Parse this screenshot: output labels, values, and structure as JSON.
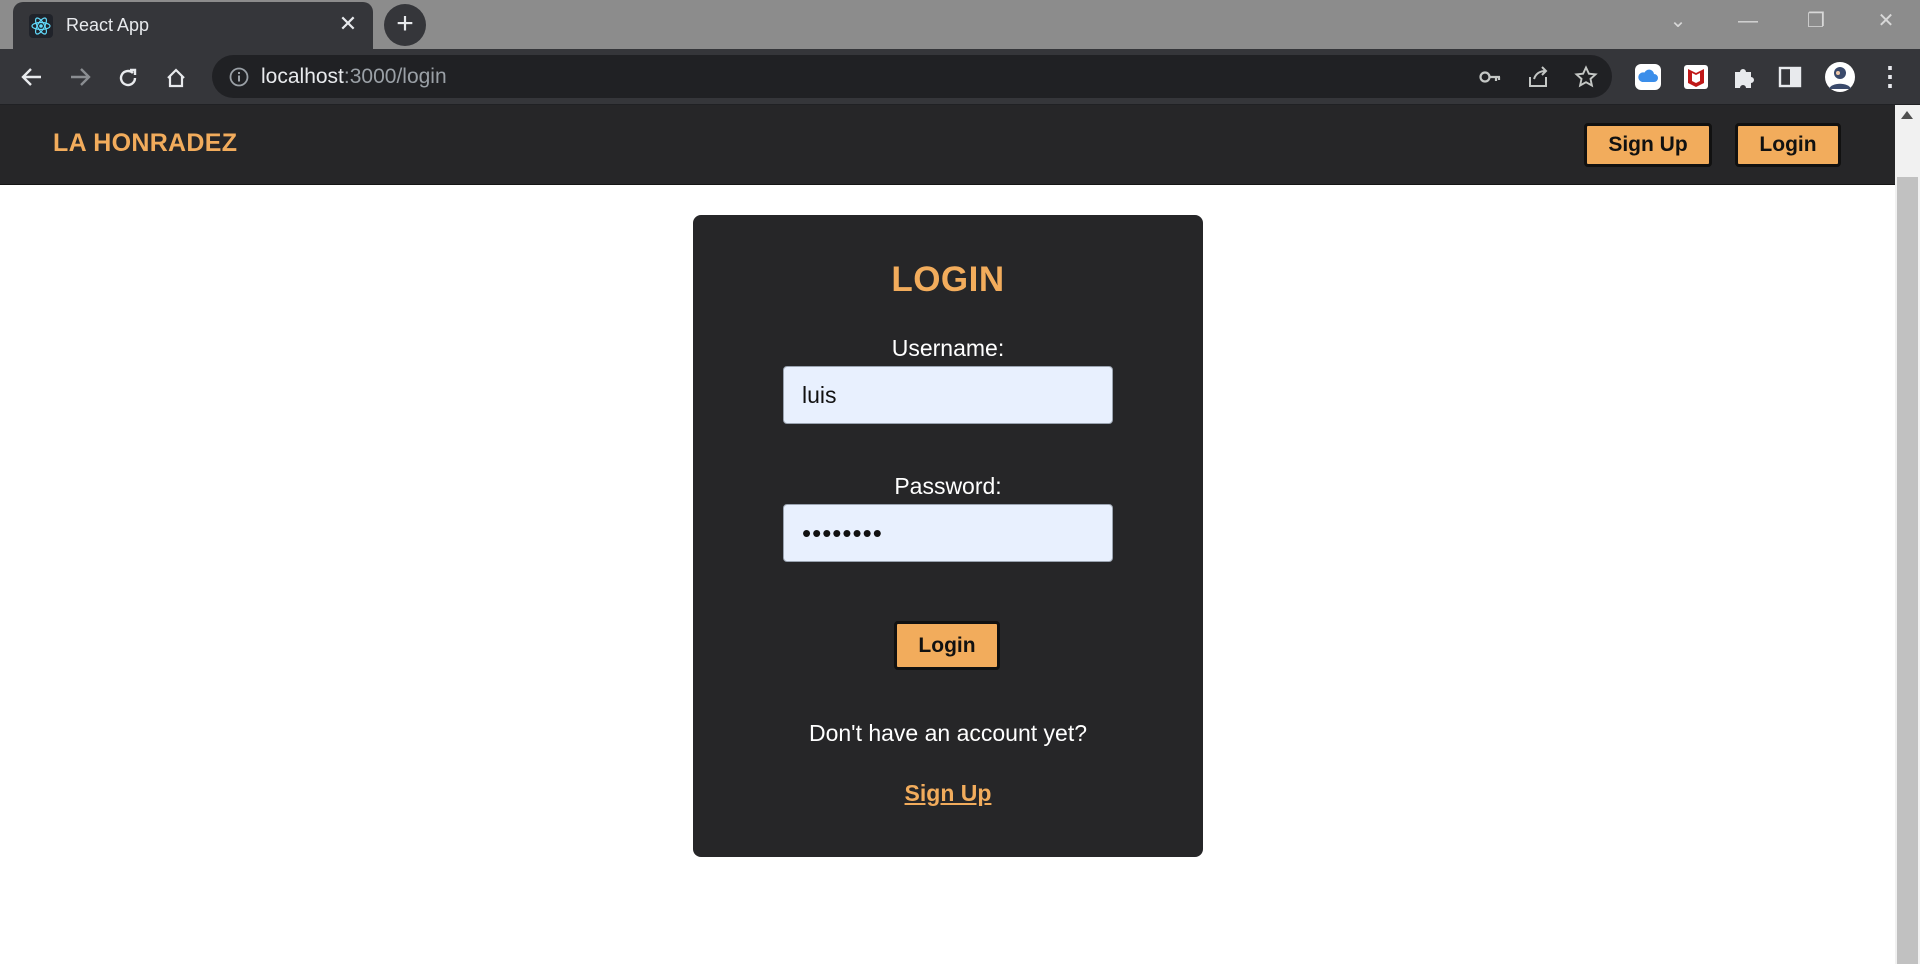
{
  "browser": {
    "tab_title": "React App",
    "tab_close": "✕",
    "new_tab": "+",
    "url_host": "localhost",
    "url_path": ":3000/login",
    "window_controls": [
      "⌄",
      "—",
      "❐",
      "✕"
    ]
  },
  "navbar": {
    "brand": "LA HONRADEZ",
    "signup_label": "Sign Up",
    "login_label": "Login"
  },
  "login_card": {
    "title": "LOGIN",
    "username_label": "Username:",
    "username_value": "luis",
    "password_label": "Password:",
    "password_value": "••••••••",
    "submit_label": "Login",
    "no_account_text": "Don't have an account yet?",
    "signup_link": "Sign Up"
  },
  "colors": {
    "accent": "#f2ac5c",
    "navbar_bg": "#262628",
    "card_bg": "#262628",
    "input_bg": "#e8f0fe"
  }
}
